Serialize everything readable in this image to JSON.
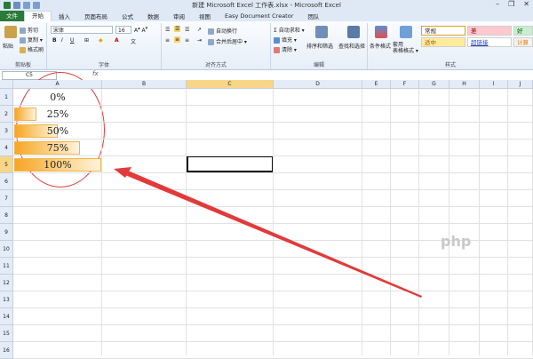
{
  "window": {
    "title": "新建 Microsoft Excel 工作表.xlsx - Microsoft Excel",
    "minimize": "–",
    "restore": "❐",
    "close": "✕"
  },
  "menu": [
    "文件",
    "开始",
    "插入",
    "页面布局",
    "公式",
    "数据",
    "审阅",
    "视图",
    "Easy Document Creator",
    "团队"
  ],
  "ribbon": {
    "clipboard": {
      "paste": "粘贴",
      "cut": "剪切",
      "copy": "复制 ▾",
      "format_painter": "格式刷",
      "label": "剪贴板"
    },
    "font": {
      "name": "宋体",
      "size": "16",
      "label": "字体"
    },
    "alignment": {
      "wrap": "自动换行",
      "merge": "合并后居中 ▾",
      "label": "对齐方式"
    },
    "editing": {
      "autosum": "自动求和 ▾",
      "fill": "填充 ▾",
      "clear": "清除 ▾",
      "sort": "排序和筛选",
      "find": "查找和选择",
      "label": "编辑"
    },
    "styles": {
      "conditional": "条件格式",
      "table": "套用\n表格格式 ▾",
      "normal": "常规",
      "bad": "差",
      "good": "好",
      "neutral": "适中",
      "hyperlink": "超链接",
      "calc": "计算",
      "label": "样式"
    }
  },
  "formula_bar": {
    "name_box": "C5",
    "fx": "fx"
  },
  "columns": [
    "A",
    "B",
    "C",
    "D",
    "E",
    "F",
    "G",
    "H",
    "I",
    "J"
  ],
  "rows": [
    "1",
    "2",
    "3",
    "4",
    "5",
    "6",
    "7",
    "8",
    "9",
    "10",
    "11",
    "12",
    "13",
    "14",
    "15",
    "16"
  ],
  "cells": [
    {
      "value": "0%",
      "pct": 0
    },
    {
      "value": "25%",
      "pct": 25
    },
    {
      "value": "50%",
      "pct": 50
    },
    {
      "value": "75%",
      "pct": 75
    },
    {
      "value": "100%",
      "pct": 100
    }
  ],
  "watermark": "php",
  "colors": {
    "accent": "#f6a623",
    "annotation": "#e23a3a",
    "file_tab": "#2a7a39"
  }
}
